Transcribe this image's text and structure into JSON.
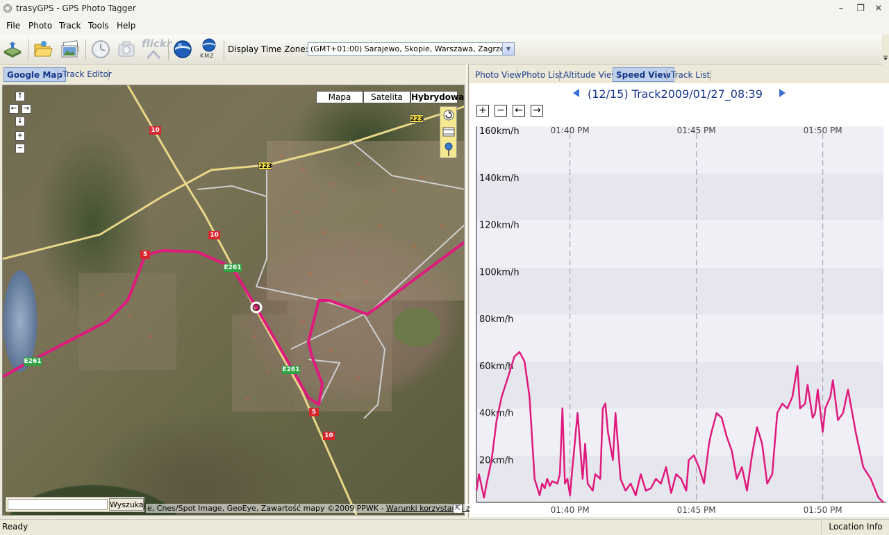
{
  "window": {
    "title": "trasyGPS - GPS Photo Tagger"
  },
  "menu": [
    "File",
    "Photo",
    "Track",
    "Tools",
    "Help"
  ],
  "toolbar": {
    "icons": [
      "import-gps-icon",
      "open-folder-icon",
      "photos-icon",
      "clock-icon",
      "camera-icon",
      "flickr-icon",
      "google-earth-icon",
      "kmz-icon"
    ],
    "flickr_label": "flickr",
    "kmz_label": "KMZ",
    "timezone_label": "Display Time Zone:",
    "timezone_value": "(GMT+01:00) Sarajewo, Skopie, Warszawa, Zagrzeb"
  },
  "left_tabs": [
    "Google Map",
    "Track Editor"
  ],
  "left_active_tab": 0,
  "map": {
    "map_types": [
      "Mapa",
      "Satelita",
      "Hybrydowa"
    ],
    "active_map_type": 2,
    "zoom_in": "+",
    "zoom_out": "−",
    "search_placeholder": "",
    "search_button": "Wyszukaj",
    "attribution": "e, Cnes/Spot Image, GeoEye, Zawartość mapy ©2009 PPWK - ",
    "attribution_link": "Warunki korzystania z usługi",
    "road_shields": [
      {
        "label": "10",
        "color": "#d8262f"
      },
      {
        "label": "223",
        "color": "#f5e14a"
      },
      {
        "label": "223",
        "color": "#f5e14a"
      },
      {
        "label": "10",
        "color": "#d8262f"
      },
      {
        "label": "5",
        "color": "#d8262f"
      },
      {
        "label": "E261",
        "color": "#2fa344"
      },
      {
        "label": "E261",
        "color": "#2fa344"
      },
      {
        "label": "E261",
        "color": "#2fa344"
      },
      {
        "label": "5",
        "color": "#d8262f"
      },
      {
        "label": "10",
        "color": "#d8262f"
      }
    ],
    "track_color": "#e0197d"
  },
  "right_tabs": [
    "Photo View",
    "Photo List",
    "Altitude View",
    "Speed View",
    "Track List"
  ],
  "right_active_tab": 3,
  "track_header": "(12/15) Track2009/01/27_08:39",
  "zoom_buttons": [
    "+",
    "−",
    "←",
    "→"
  ],
  "status": {
    "text": "Ready",
    "location_info": "Location Info"
  },
  "chart_data": {
    "type": "line",
    "title": "",
    "xlabel": "",
    "ylabel": "",
    "ylim": [
      0,
      160
    ],
    "y_ticks": [
      "20km/h",
      "40km/h",
      "60km/h",
      "80km/h",
      "100km/h",
      "120km/h",
      "140km/h",
      "160km/h"
    ],
    "y_tick_values": [
      20,
      40,
      60,
      80,
      100,
      120,
      140,
      160
    ],
    "x_ticks": [
      "01:40 PM",
      "01:45 PM",
      "01:50 PM"
    ],
    "x_tick_values": [
      100,
      105,
      110
    ],
    "x_range": [
      96.3,
      112.4
    ],
    "x_unit": "minutes after 12:00 PM",
    "color": "#e0197d",
    "series": [
      {
        "x": [
          96.3,
          96.4,
          96.6,
          96.7,
          96.9,
          97.1,
          97.3,
          97.6,
          97.8,
          98.0,
          98.2,
          98.4,
          98.6,
          98.8,
          98.9,
          99.0,
          99.1,
          99.2,
          99.3,
          99.5,
          99.6,
          99.7,
          99.8,
          99.9,
          100.0,
          100.1,
          100.3,
          100.5,
          100.6,
          100.7,
          100.9,
          101.0,
          101.2,
          101.3,
          101.4,
          101.5,
          101.7,
          101.8,
          102.0,
          102.2,
          102.4,
          102.6,
          102.8,
          103.0,
          103.2,
          103.4,
          103.6,
          103.8,
          104.0,
          104.2,
          104.4,
          104.6,
          104.7,
          104.9,
          105.1,
          105.3,
          105.5,
          105.6,
          105.8,
          106.0,
          106.2,
          106.4,
          106.6,
          106.8,
          107.0,
          107.2,
          107.4,
          107.6,
          107.8,
          108.0,
          108.2,
          108.4,
          108.6,
          108.8,
          109.0,
          109.1,
          109.3,
          109.4,
          109.6,
          109.7,
          109.8,
          110.0,
          110.1,
          110.3,
          110.4,
          110.6,
          110.8,
          111.0,
          111.3,
          111.6,
          111.9,
          112.2,
          112.4
        ],
        "y": [
          5,
          12,
          2,
          8,
          18,
          35,
          45,
          55,
          62,
          64,
          60,
          45,
          10,
          3,
          8,
          6,
          10,
          7,
          9,
          8,
          12,
          40,
          8,
          10,
          3,
          15,
          38,
          10,
          25,
          8,
          5,
          12,
          10,
          40,
          42,
          30,
          18,
          38,
          10,
          5,
          8,
          3,
          12,
          5,
          6,
          10,
          8,
          15,
          4,
          12,
          10,
          5,
          18,
          20,
          15,
          8,
          25,
          30,
          38,
          36,
          28,
          22,
          10,
          15,
          5,
          20,
          32,
          25,
          8,
          12,
          38,
          42,
          40,
          45,
          58,
          40,
          42,
          50,
          36,
          38,
          48,
          30,
          40,
          45,
          52,
          35,
          38,
          48,
          30,
          15,
          10,
          2,
          0
        ]
      }
    ]
  }
}
